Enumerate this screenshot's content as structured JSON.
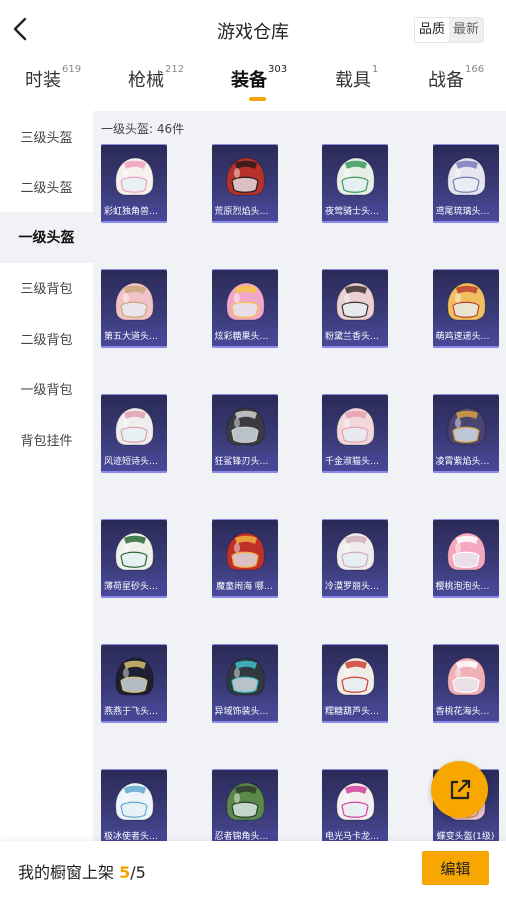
{
  "header": {
    "title": "游戏仓库",
    "sort_options": [
      "品质",
      "最新"
    ]
  },
  "tabs": [
    {
      "label": "时装",
      "count": "619"
    },
    {
      "label": "枪械",
      "count": "212"
    },
    {
      "label": "装备",
      "count": "303"
    },
    {
      "label": "载具",
      "count": "1"
    },
    {
      "label": "战备",
      "count": "166"
    }
  ],
  "sidebar": [
    "三级头盔",
    "二级头盔",
    "一级头盔",
    "三级背包",
    "二级背包",
    "一级背包",
    "背包挂件"
  ],
  "content": {
    "count_label": "一级头盔: 46件",
    "items": [
      {
        "name": "彩虹独角兽头…",
        "color": "#f4f1ee",
        "accent": "#f0a0c0"
      },
      {
        "name": "荒原烈焰头盔…",
        "color": "#b8322b",
        "accent": "#2a1a1a"
      },
      {
        "name": "夜莺骑士头盔…",
        "color": "#e8efe8",
        "accent": "#3a9a5a"
      },
      {
        "name": "鸢尾琉璃头盔…",
        "color": "#e6e6f0",
        "accent": "#7a7ab8"
      },
      {
        "name": "第五大道头盔…",
        "color": "#f2c2c8",
        "accent": "#c9a77a"
      },
      {
        "name": "炫彩糖果头盔…",
        "color": "#f0a8c8",
        "accent": "#f6c640"
      },
      {
        "name": "粉黛兰香头盔…",
        "color": "#ead0d0",
        "accent": "#3a3030"
      },
      {
        "name": "萌鸡速递头盔…",
        "color": "#f0c060",
        "accent": "#c04030"
      },
      {
        "name": "风迹短诗头盔…",
        "color": "#eeeeee",
        "accent": "#e0a0b0"
      },
      {
        "name": "狂鲨锋刃头盔…",
        "color": "#3a3a40",
        "accent": "#d0d0d0"
      },
      {
        "name": "千金淑猫头盔…",
        "color": "#f0d8dc",
        "accent": "#e8a0b0"
      },
      {
        "name": "凌霄紫焰头盔…",
        "color": "#4a4470",
        "accent": "#d8a040"
      },
      {
        "name": "薄荷星砂头盔…",
        "color": "#f0f0ea",
        "accent": "#2a6a3a"
      },
      {
        "name": "魔童闹海 哪…",
        "color": "#c0302a",
        "accent": "#f0b040"
      },
      {
        "name": "冷漠罗丽头盔…",
        "color": "#f0ecee",
        "accent": "#d0b0b8"
      },
      {
        "name": "樱桃泡泡头盔…",
        "color": "#f4a8c0",
        "accent": "#ffffff"
      },
      {
        "name": "燕燕于飞头盔…",
        "color": "#1e2032",
        "accent": "#d8c070"
      },
      {
        "name": "异域饰装头盔…",
        "color": "#303840",
        "accent": "#40c0c8"
      },
      {
        "name": "糯糖葫芦头盔…",
        "color": "#f0ece8",
        "accent": "#d04030"
      },
      {
        "name": "香桃花海头盔…",
        "color": "#f0b0b8",
        "accent": "#ffffff"
      },
      {
        "name": "极冰使者头盔…",
        "color": "#eef4f8",
        "accent": "#60a8d0"
      },
      {
        "name": "忍者锦角头盔…",
        "color": "#5a8a4a",
        "accent": "#303830"
      },
      {
        "name": "电光马卡龙头…",
        "color": "#f4f0f0",
        "accent": "#d040a0"
      },
      {
        "name": "蝶变头盔(1级)",
        "color": "#f0c8d8",
        "accent": "#e89050"
      }
    ]
  },
  "bottom": {
    "shelf_label": "我的橱窗上架",
    "shelf_used": "5",
    "shelf_sep": "/",
    "shelf_total": "5",
    "edit_label": "编辑"
  },
  "colors": {
    "accent": "#f7a700",
    "card_bg": "#33336e",
    "content_bg": "#f1f2f6"
  }
}
